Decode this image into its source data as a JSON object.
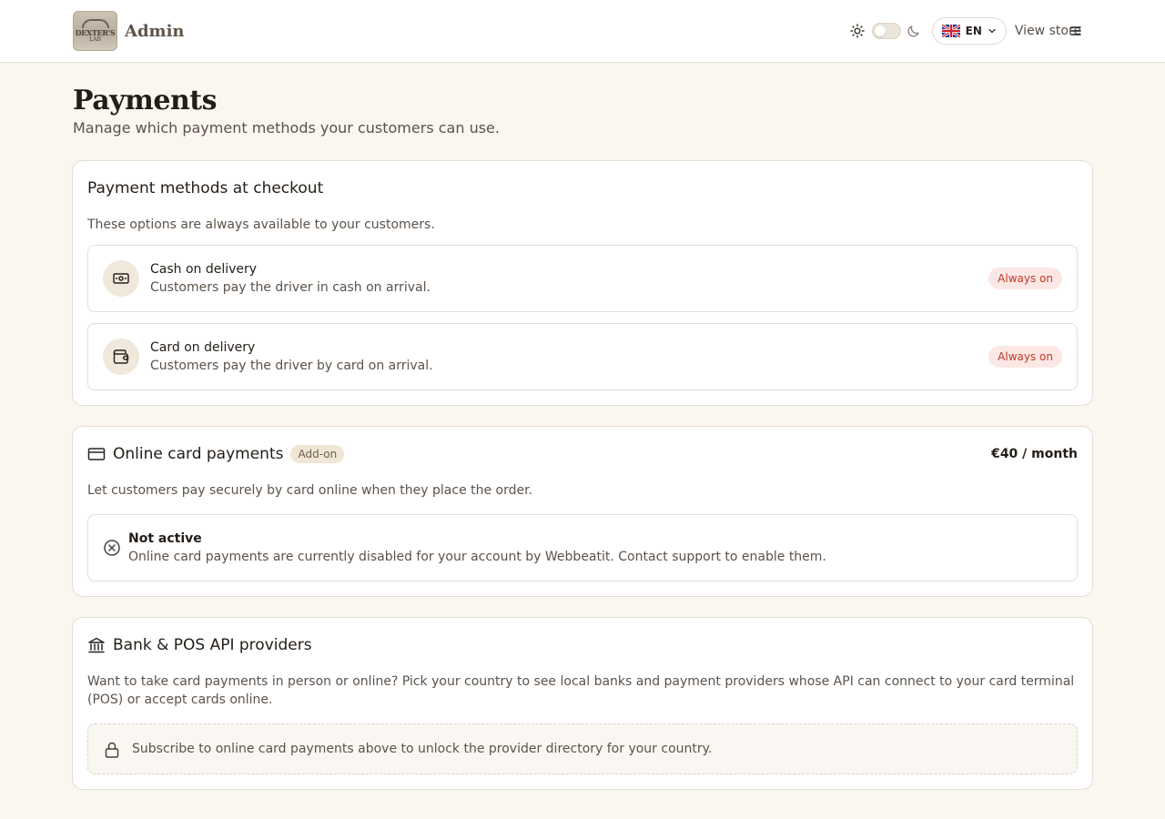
{
  "header": {
    "logo_text": "DEXTER'S",
    "logo_sub": "LAB",
    "brand_title": "Admin",
    "language_code": "EN",
    "view_store_label": "View store"
  },
  "page": {
    "title": "Payments",
    "subtitle": "Manage which payment methods your customers can use."
  },
  "checkout_card": {
    "title": "Payment methods at checkout",
    "description": "These options are always available to your customers.",
    "methods": [
      {
        "title": "Cash on delivery",
        "description": "Customers pay the driver in cash on arrival.",
        "badge": "Always on",
        "icon": "banknote-icon"
      },
      {
        "title": "Card on delivery",
        "description": "Customers pay the driver by card on arrival.",
        "badge": "Always on",
        "icon": "wallet-icon"
      }
    ]
  },
  "online_card": {
    "title": "Online card payments",
    "addon_label": "Add-on",
    "price": "€40 / month",
    "description": "Let customers pay securely by card online when they place the order.",
    "status_title": "Not active",
    "status_description": "Online card payments are currently disabled for your account by Webbeatit. Contact support to enable them."
  },
  "bank_card": {
    "title": "Bank & POS API providers",
    "description": "Want to take card payments in person or online? Pick your country to see local banks and payment providers whose API can connect to your card terminal (POS) or accept cards online.",
    "locked_message": "Subscribe to online card payments above to unlock the provider directory for your country."
  },
  "colors": {
    "page_background": "#faf6f0",
    "badge_red": "#c0392b",
    "badge_red_bg": "#fbe8e4",
    "icon_circle_bg": "#f1e8dc"
  }
}
